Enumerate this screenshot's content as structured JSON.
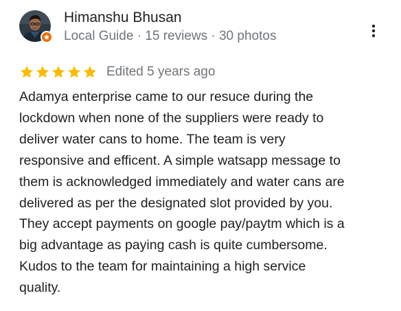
{
  "reviewer": {
    "name": "Himanshu Bhusan",
    "meta": "Local Guide · 15 reviews · 30 photos",
    "avatar_icon": "avatar-photo-icon",
    "badge_icon": "local-guide-star-icon"
  },
  "actions": {
    "more_icon": "more-vert-icon"
  },
  "rating": {
    "stars": 5,
    "max_stars": 5,
    "star_color": "#fbbc04",
    "edited_text": "Edited 5 years ago"
  },
  "review": {
    "lines": [
      "Adamya enterprise came to our resuce during the",
      "lockdown when none of the suppliers were ready to",
      "deliver water cans to home. The team is very",
      "responsive and efficent. A simple watsapp message to",
      "them is acknowledged immediately and water cans are",
      "delivered as per the designated slot provided by you.",
      "They accept payments on google pay/paytm which is a",
      "big advantage as paying cash is quite cumbersome.",
      "Kudos to the team for maintaining a high service",
      "quality."
    ]
  },
  "colors": {
    "primary_text": "#1f1f1f",
    "secondary_text": "#70757a",
    "badge": "#e8710a"
  }
}
